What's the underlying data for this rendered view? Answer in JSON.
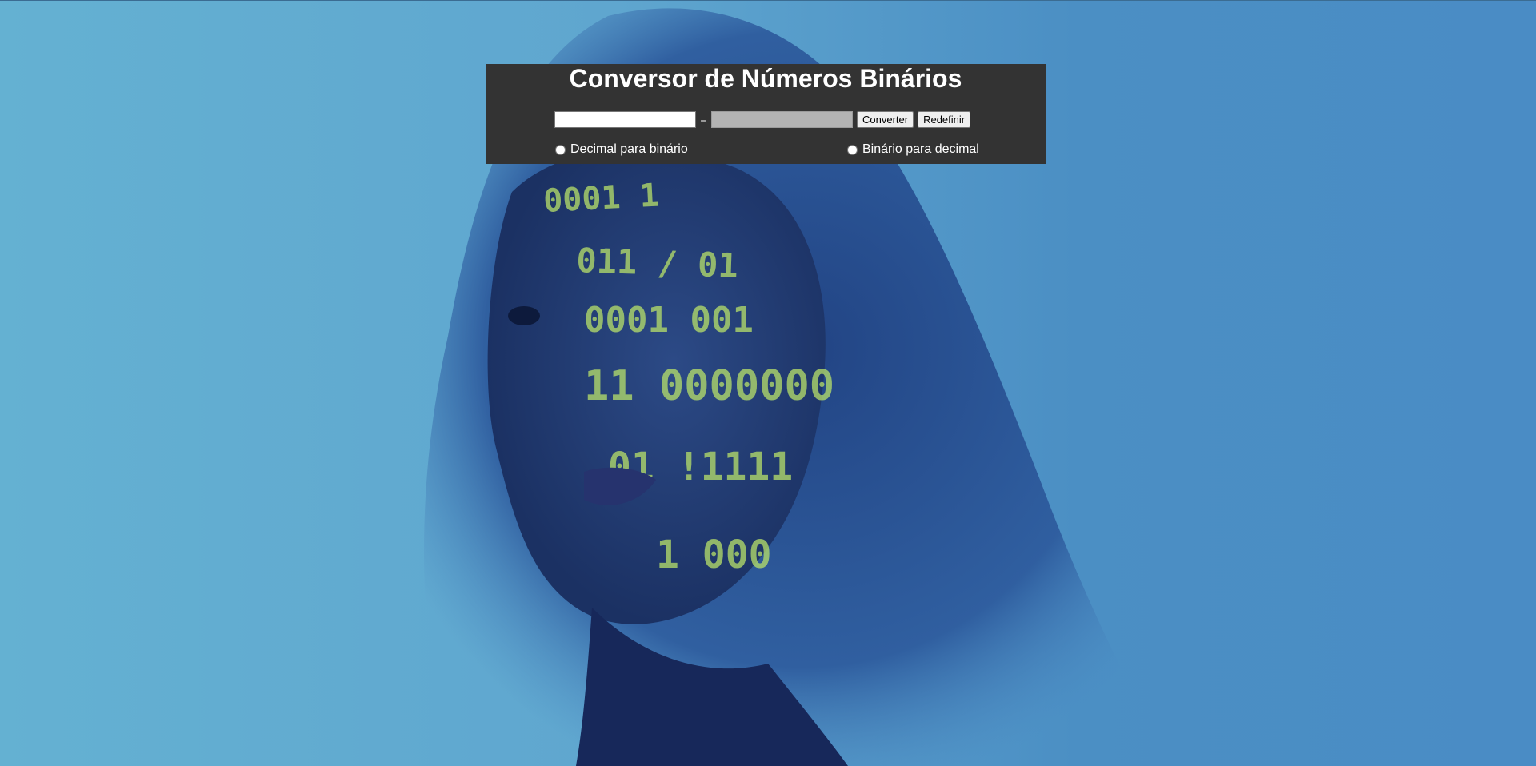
{
  "page": {
    "title": "Conversor de Números Binários"
  },
  "converter": {
    "input_value": "",
    "output_value": "",
    "equals": "=",
    "convert_label": "Converter",
    "reset_label": "Redefinir"
  },
  "modes": [
    {
      "label": "Decimal para binário",
      "checked": false
    },
    {
      "label": "Binário para decimal",
      "checked": false
    }
  ],
  "colors": {
    "panel_background": "#333333",
    "page_background": "#5fa6cf"
  }
}
